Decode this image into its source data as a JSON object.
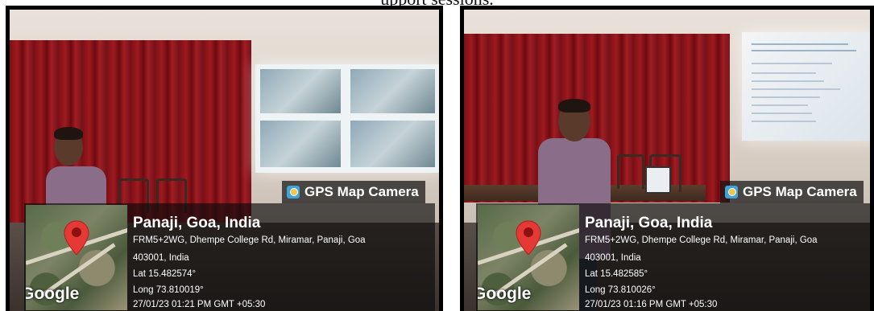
{
  "top_caption": "upport sessions.",
  "photos": [
    {
      "badge_label": "GPS Map Camera",
      "map_logo": "Google",
      "place": "Panaji, Goa, India",
      "address_line1": "FRM5+2WG, Dhempe College Rd, Miramar, Panaji, Goa",
      "address_line2": "403001, India",
      "lat": "Lat 15.482574°",
      "long": "Long 73.810019°",
      "datetime": "27/01/23 01:21 PM GMT +05:30"
    },
    {
      "badge_label": "GPS Map Camera",
      "map_logo": "Google",
      "place": "Panaji, Goa, India",
      "address_line1": "FRM5+2WG, Dhempe College Rd, Miramar, Panaji, Goa",
      "address_line2": "403001, India",
      "lat": "Lat 15.482585°",
      "long": "Long 73.810026°",
      "datetime": "27/01/23 01:16 PM GMT +05:30"
    }
  ],
  "colors": {
    "curtain": "#9e1a20",
    "overlay": "#0a0a0a",
    "pin": "#e53935",
    "badge_icon": "#3da5d9"
  }
}
